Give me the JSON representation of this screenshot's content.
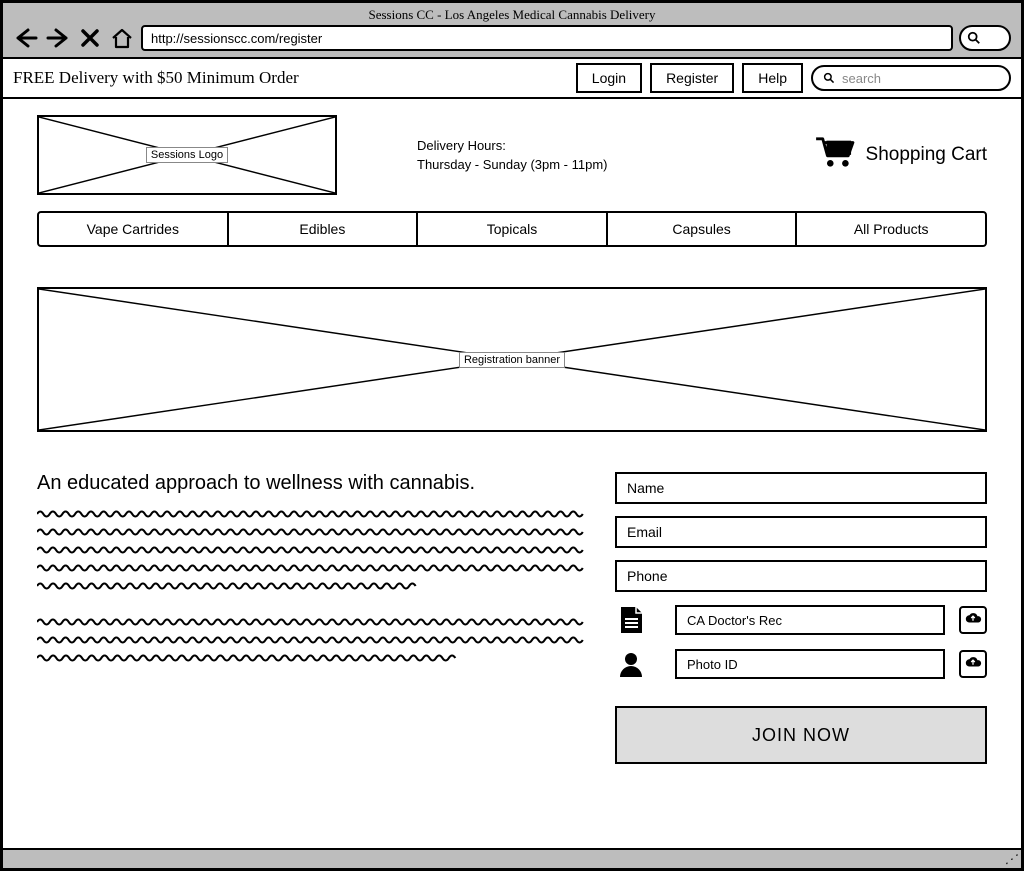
{
  "browser": {
    "title": "Sessions CC - Los Angeles Medical Cannabis Delivery",
    "url": "http://sessionscc.com/register"
  },
  "utilbar": {
    "promo": "FREE Delivery with $50 Minimum Order",
    "login": "Login",
    "register": "Register",
    "help": "Help",
    "search_placeholder": "search"
  },
  "header": {
    "logo_label": "Sessions Logo",
    "hours_label": "Delivery Hours:",
    "hours_detail": "Thursday - Sunday (3pm - 11pm)",
    "cart_label": "Shopping Cart"
  },
  "nav": {
    "tabs": [
      "Vape Cartrides",
      "Edibles",
      "Topicals",
      "Capsules",
      "All Products"
    ]
  },
  "banner": {
    "label": "Registration banner"
  },
  "intro": {
    "heading": "An educated approach to wellness with cannabis."
  },
  "form": {
    "name_label": "Name",
    "email_label": "Email",
    "phone_label": "Phone",
    "rec_label": "CA Doctor's Rec",
    "id_label": "Photo ID",
    "join_label": "JOIN NOW"
  }
}
